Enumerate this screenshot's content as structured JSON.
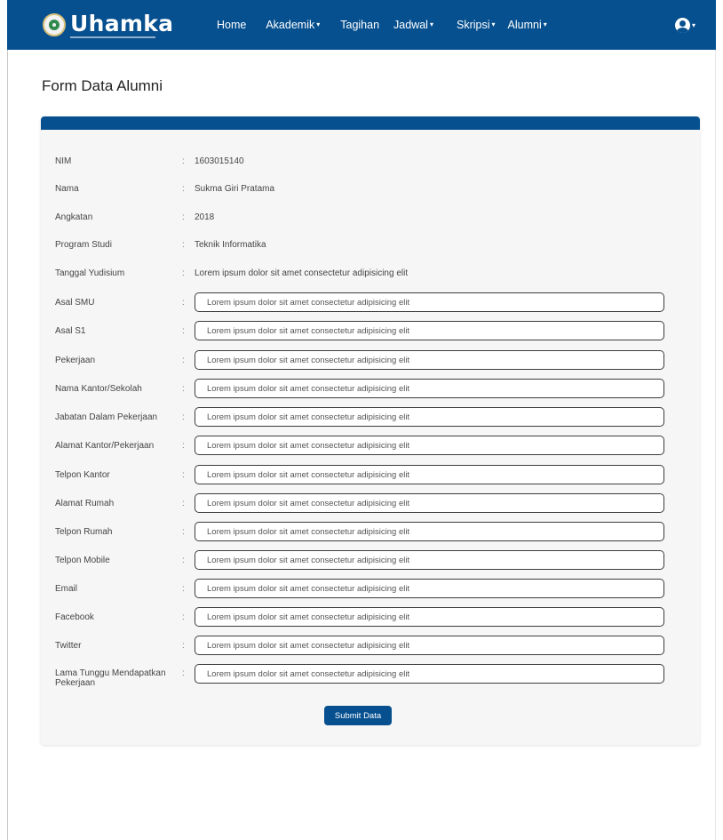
{
  "brand": {
    "name": "Uhamka"
  },
  "nav": {
    "items": [
      {
        "label": "Home",
        "caret": ""
      },
      {
        "label": "Akademik",
        "caret": "▾"
      },
      {
        "label": "Tagihan",
        "caret": ""
      },
      {
        "label": "Jadwal",
        "caret": "▾"
      },
      {
        "label": "Skripsi",
        "caret": "▾"
      },
      {
        "label": "Alumni",
        "caret": "▾"
      }
    ],
    "user_caret": "▾"
  },
  "page": {
    "title": "Form Data Alumni"
  },
  "form": {
    "separator": ":",
    "static_fields": [
      {
        "label": "NIM",
        "value": "1603015140"
      },
      {
        "label": "Nama",
        "value": "Sukma Giri Pratama"
      },
      {
        "label": "Angkatan",
        "value": "2018"
      },
      {
        "label": "Program Studi",
        "value": "Teknik Informatika"
      },
      {
        "label": "Tanggal Yudisium",
        "value": "Lorem ipsum dolor sit amet consectetur adipisicing elit"
      }
    ],
    "input_fields": [
      {
        "label": "Asal SMU",
        "value": "Lorem ipsum dolor sit amet consectetur adipisicing elit"
      },
      {
        "label": "Asal S1",
        "value": "Lorem ipsum dolor sit amet consectetur adipisicing elit"
      },
      {
        "label": "Pekerjaan",
        "value": "Lorem ipsum dolor sit amet consectetur adipisicing elit"
      },
      {
        "label": "Nama Kantor/Sekolah",
        "value": "Lorem ipsum dolor sit amet consectetur adipisicing elit"
      },
      {
        "label": "Jabatan Dalam Pekerjaan",
        "value": "Lorem ipsum dolor sit amet consectetur adipisicing elit"
      },
      {
        "label": "Alamat Kantor/Pekerjaan",
        "value": "Lorem ipsum dolor sit amet consectetur adipisicing elit"
      },
      {
        "label": "Telpon Kantor",
        "value": "Lorem ipsum dolor sit amet consectetur adipisicing elit"
      },
      {
        "label": "Alamat Rumah",
        "value": "Lorem ipsum dolor sit amet consectetur adipisicing elit"
      },
      {
        "label": "Telpon Rumah",
        "value": "Lorem ipsum dolor sit amet consectetur adipisicing elit"
      },
      {
        "label": "Telpon Mobile",
        "value": "Lorem ipsum dolor sit amet consectetur adipisicing elit"
      },
      {
        "label": "Email",
        "value": "Lorem ipsum dolor sit amet consectetur adipisicing elit"
      },
      {
        "label": "Facebook",
        "value": "Lorem ipsum dolor sit amet consectetur adipisicing elit"
      },
      {
        "label": "Twitter",
        "value": "Lorem ipsum dolor sit amet consectetur adipisicing elit"
      },
      {
        "label": "Lama Tunggu Mendapatkan Pekerjaan",
        "value": "Lorem ipsum dolor sit amet consectetur adipisicing elit"
      }
    ],
    "submit_label": "Submit Data"
  },
  "colors": {
    "primary": "#07508f",
    "card_bg": "#f6f6f6",
    "page_bg": "#ffffff"
  }
}
